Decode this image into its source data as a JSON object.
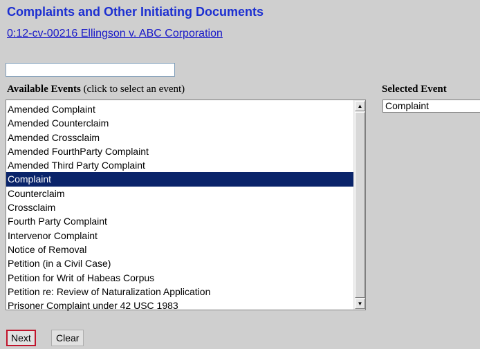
{
  "page": {
    "title": "Complaints and Other Initiating Documents",
    "case_link": "0:12-cv-00216 Ellingson v. ABC Corporation"
  },
  "search": {
    "value": "",
    "placeholder": ""
  },
  "available_events": {
    "heading_bold": "Available Events",
    "heading_hint": " (click to select an event)",
    "selected_index": 5,
    "items": [
      "Amended Complaint",
      "Amended Counterclaim",
      "Amended Crossclaim",
      "Amended FourthParty Complaint",
      "Amended Third Party Complaint",
      "Complaint",
      "Counterclaim",
      "Crossclaim",
      "Fourth Party Complaint",
      "Intervenor Complaint",
      "Notice of Removal",
      "Petition (in a Civil Case)",
      "Petition for Writ of Habeas Corpus",
      "Petition re: Review of Naturalization Application",
      "Prisoner Complaint under 42 USC 1983"
    ]
  },
  "selected_events": {
    "heading": "Selected Event",
    "items": [
      "Complaint"
    ]
  },
  "buttons": {
    "next": "Next",
    "clear": "Clear"
  },
  "icons": {
    "scroll_up": "scroll-up-arrow-icon",
    "scroll_down": "scroll-down-arrow-icon"
  },
  "colors": {
    "title": "#1c2fd1",
    "link": "#1818c8",
    "selection": "#0a246a",
    "next_outline": "#c0142b",
    "background": "#cfcfcf"
  }
}
